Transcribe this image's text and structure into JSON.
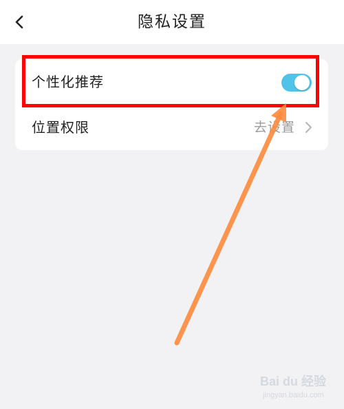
{
  "header": {
    "title": "隐私设置",
    "back_icon": "chevron-left-icon"
  },
  "settings": {
    "items": [
      {
        "label": "个性化推荐",
        "control": "toggle",
        "enabled": true
      },
      {
        "label": "位置权限",
        "value": "去设置",
        "icon": "chevron-right-icon"
      }
    ]
  },
  "colors": {
    "background": "#f2f2f4",
    "toggle_on": "#4fc3e8",
    "highlight": "#ff0000",
    "arrow": "#ff8a3d"
  },
  "watermark": {
    "text": "Bai du 经验",
    "sub": "jingyan.baidu.com"
  }
}
